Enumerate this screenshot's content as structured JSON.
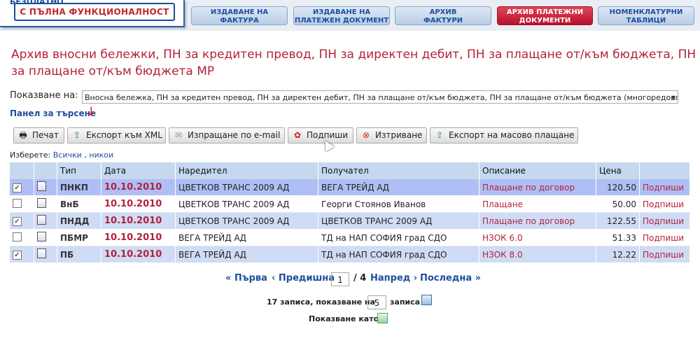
{
  "logo": {
    "top": "БЕЗПЛАТНО",
    "sub": "С ПЪЛНА ФУНКЦИОНАЛНОСТ"
  },
  "nav": [
    {
      "l1": "ИЗДАВАНЕ НА",
      "l2": "ФАКТУРА"
    },
    {
      "l1": "ИЗДАВАНЕ НА",
      "l2": "ПЛАТЕЖЕН ДОКУМЕНТ"
    },
    {
      "l1": "АРХИВ",
      "l2": "ФАКТУРИ"
    },
    {
      "l1": "АРХИВ ПЛАТЕЖНИ",
      "l2": "ДОКУМЕНТИ"
    },
    {
      "l1": "НОМЕНКЛАТУРНИ",
      "l2": "ТАБЛИЦИ"
    }
  ],
  "page_title": "Архив вносни бележки, ПН за кредитен превод, ПН за директен дебит, ПН за плащане от/към бюджета, ПН за плащане от/към бюджета МР",
  "show_label": "Показване на:",
  "show_value": "Вносна бележка, ПН за кредитен превод, ПН за директен дебит, ПН за плащане от/към бюджета, ПН за плащане от/към бюджета (многоредово)",
  "search_panel": "Панел за търсене",
  "toolbar": {
    "print": "Печат",
    "xml": "Експорт към XML",
    "email": "Изпращане по e-mail",
    "sign": "Подпиши",
    "delete": "Изтриване",
    "mass": "Експорт на масово плащане"
  },
  "select": {
    "label": "Изберете:",
    "all": "Всички",
    "sep": ",",
    "none": "никои"
  },
  "columns": {
    "type": "Тип",
    "date": "Дата",
    "sender": "Наредител",
    "receiver": "Получател",
    "desc": "Описание",
    "price": "Цена"
  },
  "rows": [
    {
      "checked": "✓",
      "type": "ПНКП",
      "date": "10.10.2010",
      "sender": "ЦВЕТКОВ ТРАНС 2009 АД",
      "receiver": "ВЕГА ТРЕЙД АД",
      "desc": "Плащане по договор",
      "price": "120.50",
      "action": "Подпиши"
    },
    {
      "checked": "",
      "type": "ВнБ",
      "date": "10.10.2010",
      "sender": "ЦВЕТКОВ ТРАНС 2009 АД",
      "receiver": "Георги Стоянов Иванов",
      "desc": "Плащане",
      "price": "50.00",
      "action": "Подпиши"
    },
    {
      "checked": "✓",
      "type": "ПНДД",
      "date": "10.10.2010",
      "sender": "ЦВЕТКОВ ТРАНС 2009 АД",
      "receiver": "ЦВЕТКОВ ТРАНС 2009 АД",
      "desc": "Плащане по договор",
      "price": "122.55",
      "action": "Подпиши"
    },
    {
      "checked": "",
      "type": "ПБМР",
      "date": "10.10.2010",
      "sender": "ВЕГА ТРЕЙД АД",
      "receiver": "ТД на НАП СОФИЯ град СДО",
      "desc": "НЗОК 6.0",
      "price": "51.33",
      "action": "Подпиши"
    },
    {
      "checked": "✓",
      "type": "ПБ",
      "date": "10.10.2010",
      "sender": "ВЕГА ТРЕЙД АД",
      "receiver": "ТД на НАП СОФИЯ град СДО",
      "desc": "НЗОК 8.0",
      "price": "12.22",
      "action": "Подпиши"
    }
  ],
  "pager": {
    "first": "« Първа",
    "prev": "‹ Предишна",
    "page": "1",
    "of": "/ 4",
    "next": "Напред ›",
    "last": "Последна »"
  },
  "records": {
    "prefix": "17 записа, показване на",
    "count": "5",
    "suffix": "записа"
  },
  "show_as": "Показване като:"
}
